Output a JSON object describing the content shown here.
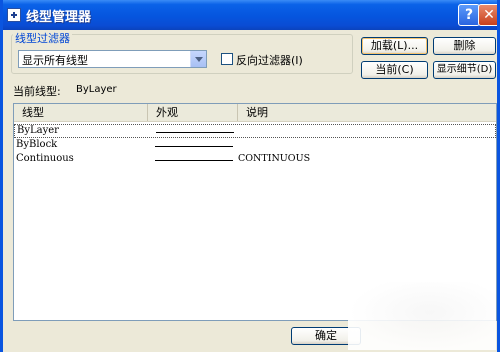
{
  "window": {
    "title": "线型管理器",
    "help_glyph": "?",
    "close_glyph": "✕"
  },
  "filter": {
    "group_label": "线型过滤器",
    "selected": "显示所有线型",
    "invert_label": "反向过滤器(I)",
    "invert_checked": false
  },
  "buttons": {
    "load": "加载(L)...",
    "delete": "删除",
    "current": "当前(C)",
    "details": "显示细节(D)",
    "ok": "确定"
  },
  "current": {
    "label": "当前线型:",
    "value": "ByLayer"
  },
  "list": {
    "columns": [
      "线型",
      "外观",
      "说明"
    ],
    "rows": [
      {
        "name": "ByLayer",
        "description": ""
      },
      {
        "name": "ByBlock",
        "description": ""
      },
      {
        "name": "Continuous",
        "description": "CONTINUOUS"
      }
    ]
  },
  "colors": {
    "title_bar": "#0a55e0",
    "dialog_bg": "#ece9d8",
    "group_label": "#0046d5"
  },
  "icons": {
    "app": "linetype-app-icon",
    "dropdown": "chevron-down-icon"
  }
}
